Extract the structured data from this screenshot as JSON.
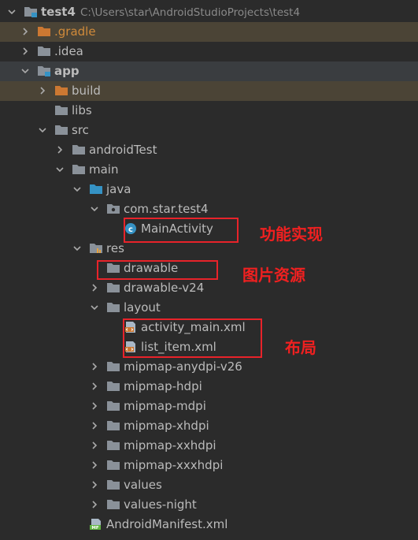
{
  "project": {
    "name": "test4",
    "path": "C:\\Users\\star\\AndroidStudioProjects\\test4"
  },
  "tree": [
    {
      "label": "test4",
      "level": 0,
      "arrow": "down",
      "icon": "module-folder-icon",
      "bold": true
    },
    {
      "label": ".gradle",
      "level": 1,
      "arrow": "right",
      "icon": "orange-folder-icon",
      "row_state": "highlighted",
      "color": "orange"
    },
    {
      "label": ".idea",
      "level": 1,
      "arrow": "right",
      "icon": "folder-icon"
    },
    {
      "label": "app",
      "level": 1,
      "arrow": "down",
      "icon": "module-folder-icon",
      "bold": true,
      "row_state": "selected"
    },
    {
      "label": "build",
      "level": 2,
      "arrow": "right",
      "icon": "orange-folder-icon",
      "row_state": "highlighted"
    },
    {
      "label": "libs",
      "level": 2,
      "arrow": "none",
      "icon": "folder-icon"
    },
    {
      "label": "src",
      "level": 2,
      "arrow": "down",
      "icon": "folder-icon"
    },
    {
      "label": "androidTest",
      "level": 3,
      "arrow": "right",
      "icon": "folder-icon"
    },
    {
      "label": "main",
      "level": 3,
      "arrow": "down",
      "icon": "folder-icon"
    },
    {
      "label": "java",
      "level": 4,
      "arrow": "down",
      "icon": "source-folder-icon"
    },
    {
      "label": "com.star.test4",
      "level": 5,
      "arrow": "down",
      "icon": "package-icon"
    },
    {
      "label": "MainActivity",
      "level": 6,
      "arrow": "none",
      "icon": "class-icon"
    },
    {
      "label": "res",
      "level": 4,
      "arrow": "down",
      "icon": "resource-folder-icon"
    },
    {
      "label": "drawable",
      "level": 5,
      "arrow": "none",
      "icon": "folder-icon"
    },
    {
      "label": "drawable-v24",
      "level": 5,
      "arrow": "right",
      "icon": "folder-icon"
    },
    {
      "label": "layout",
      "level": 5,
      "arrow": "down",
      "icon": "folder-icon"
    },
    {
      "label": "activity_main.xml",
      "level": 6,
      "arrow": "none",
      "icon": "xml-file-icon"
    },
    {
      "label": "list_item.xml",
      "level": 6,
      "arrow": "none",
      "icon": "xml-file-icon"
    },
    {
      "label": "mipmap-anydpi-v26",
      "level": 5,
      "arrow": "right",
      "icon": "folder-icon"
    },
    {
      "label": "mipmap-hdpi",
      "level": 5,
      "arrow": "right",
      "icon": "folder-icon"
    },
    {
      "label": "mipmap-mdpi",
      "level": 5,
      "arrow": "right",
      "icon": "folder-icon"
    },
    {
      "label": "mipmap-xhdpi",
      "level": 5,
      "arrow": "right",
      "icon": "folder-icon"
    },
    {
      "label": "mipmap-xxhdpi",
      "level": 5,
      "arrow": "right",
      "icon": "folder-icon"
    },
    {
      "label": "mipmap-xxxhdpi",
      "level": 5,
      "arrow": "right",
      "icon": "folder-icon"
    },
    {
      "label": "values",
      "level": 5,
      "arrow": "right",
      "icon": "folder-icon"
    },
    {
      "label": "values-night",
      "level": 5,
      "arrow": "right",
      "icon": "folder-icon"
    },
    {
      "label": "AndroidManifest.xml",
      "level": 4,
      "arrow": "none",
      "icon": "manifest-file-icon"
    }
  ],
  "annotations": {
    "activity": "功能实现",
    "drawable": "图片资源",
    "layout": "布局"
  },
  "colors": {
    "background": "#2b2b2b",
    "text": "#bbbbbb",
    "excluded_text": "#d08a3a",
    "highlight_row": "#4b4436",
    "selected_row": "#3a3d40",
    "annotation": "#f02020"
  }
}
